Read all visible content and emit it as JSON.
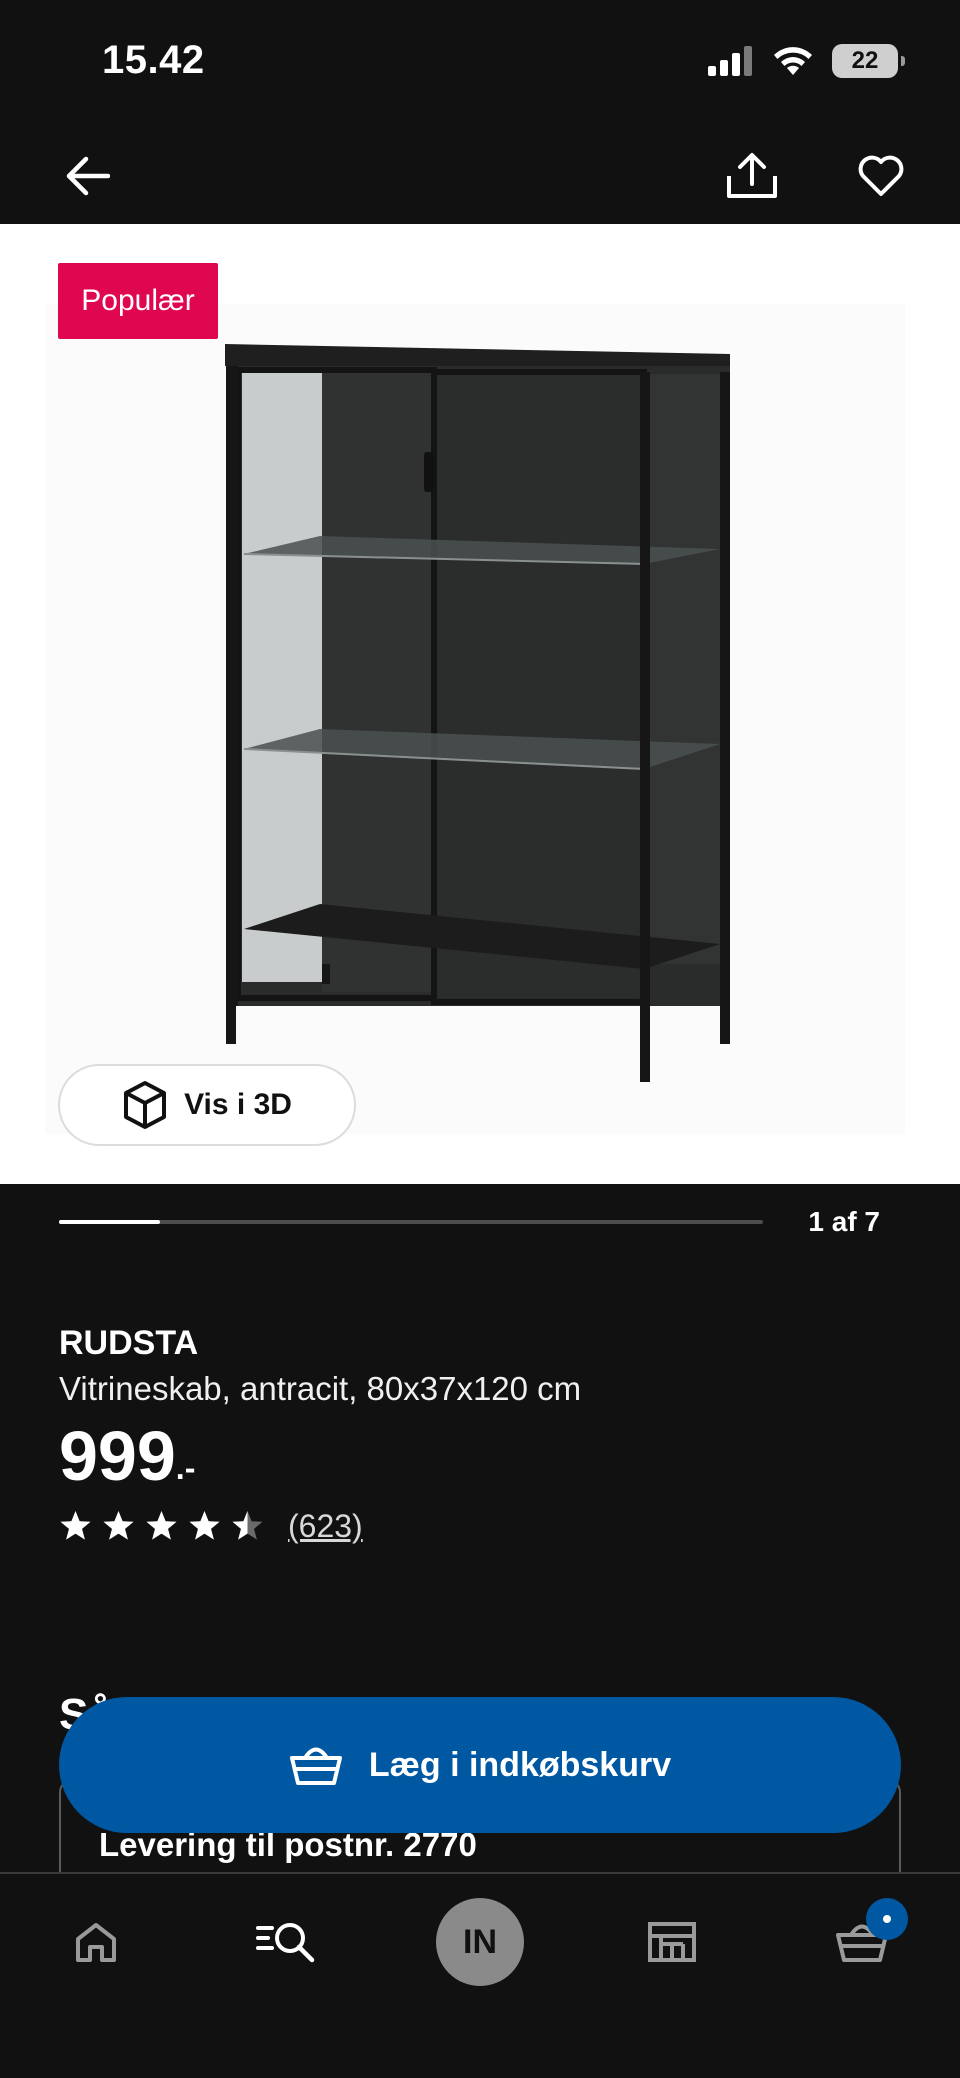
{
  "status_bar": {
    "time": "15.42",
    "battery": "22",
    "icons": [
      "cellular-signal-icon",
      "wifi-icon",
      "battery-icon"
    ]
  },
  "top_nav": {
    "icons": [
      "back-arrow-icon",
      "share-icon",
      "heart-icon"
    ]
  },
  "gallery": {
    "badge": "Populær",
    "view_3d_label": "Vis i 3D",
    "image_index": 1,
    "image_count": 7,
    "page_label": "1 af 7",
    "progress_fraction": 0.143
  },
  "product": {
    "name": "RUDSTA",
    "description": "Vitrineskab, antracit, 80x37x120 cm",
    "price": "999",
    "price_suffix": ".-",
    "rating": 4.5,
    "rating_max": 5,
    "review_count": "(623)"
  },
  "partial_section": {
    "heading_visible_part": "Så",
    "delivery_text": "Levering til postnr. 2770"
  },
  "cart_button": {
    "label": "Læg i indkøbskurv",
    "icon": "basket-icon"
  },
  "tab_bar": {
    "tabs": [
      {
        "name": "home",
        "icon": "home-icon"
      },
      {
        "name": "search",
        "icon": "search-icon"
      },
      {
        "name": "profile",
        "initials": "IN"
      },
      {
        "name": "store",
        "icon": "store-icon"
      },
      {
        "name": "cart",
        "icon": "basket-icon"
      }
    ]
  },
  "colors": {
    "background": "#111111",
    "badge": "#e00751",
    "accent_blue": "#0058a3"
  }
}
